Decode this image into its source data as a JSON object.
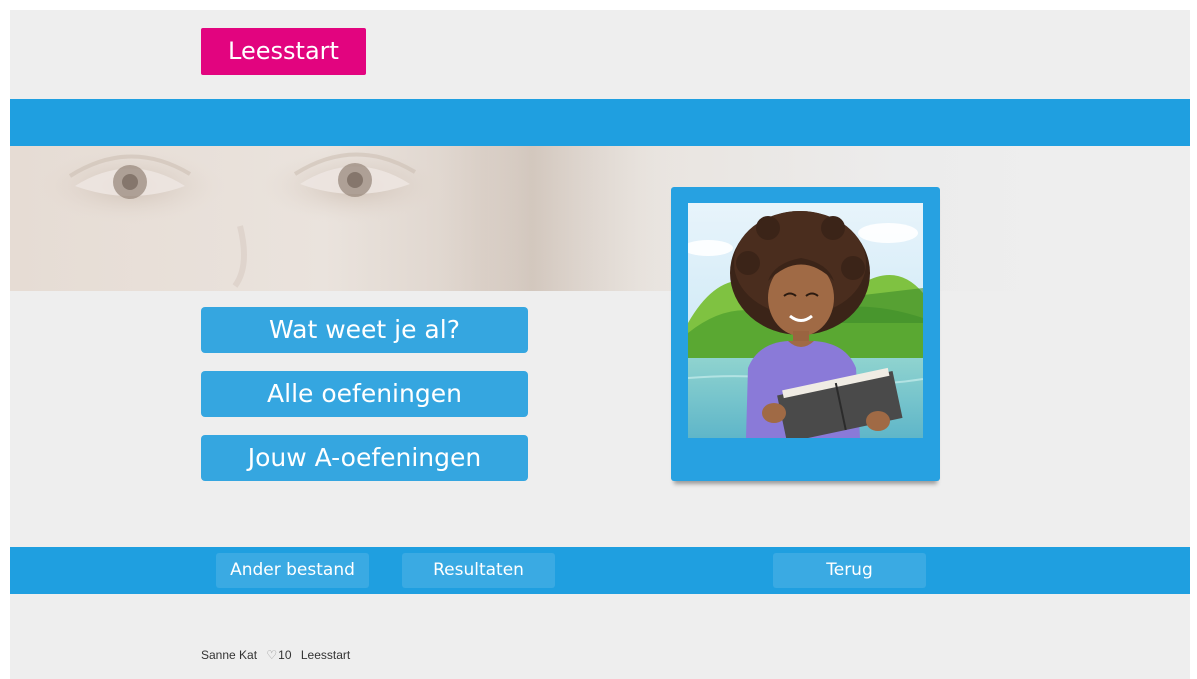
{
  "header": {
    "logo_label": "Leesstart"
  },
  "menu": {
    "items": [
      {
        "label": "Wat weet je al?"
      },
      {
        "label": "Alle oefeningen"
      },
      {
        "label": "Jouw A-oefeningen"
      }
    ]
  },
  "nav": {
    "other_file_label": "Ander bestand",
    "results_label": "Resultaten",
    "back_label": "Terug"
  },
  "footer": {
    "user_name": "Sanne Kat",
    "heart_icon": "heart-outline-icon",
    "heart_glyph": "♡",
    "hearts_count": "10",
    "app_name": "Leesstart"
  },
  "colors": {
    "brand_pink": "#e2047f",
    "accent_blue": "#1f9fe0",
    "button_blue": "#35a6e0",
    "background": "#eeeeee"
  }
}
